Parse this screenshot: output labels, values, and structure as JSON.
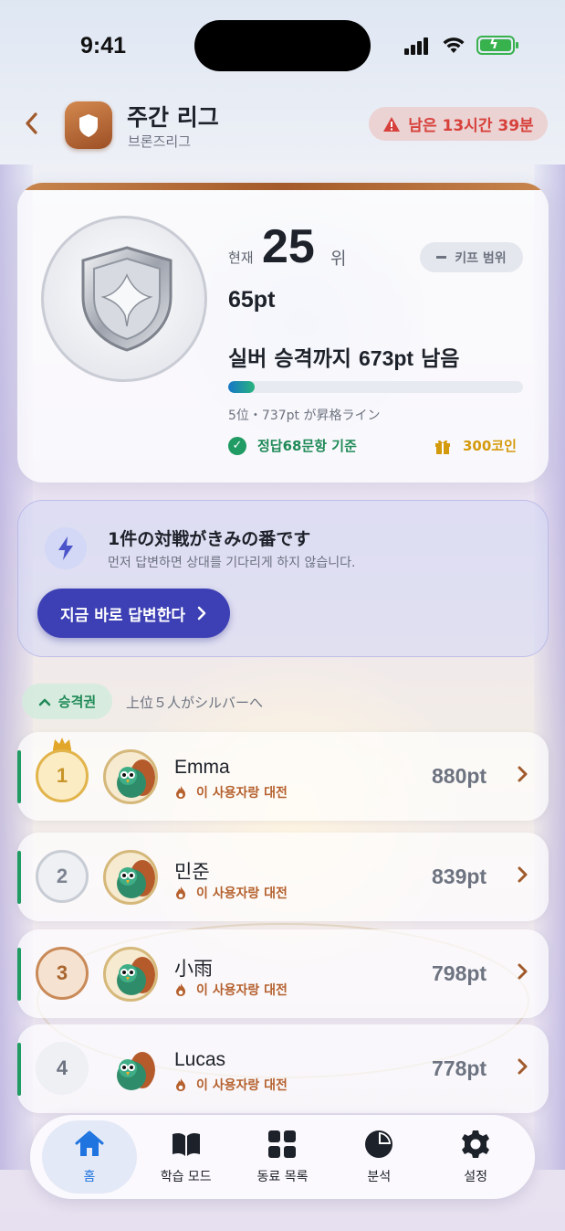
{
  "status_bar": {
    "time": "9:41"
  },
  "header": {
    "title": "주간 리그",
    "subtitle": "브론즈리그",
    "time_left_prefix": "남은 ",
    "time_left_value": "13시간 39분"
  },
  "rank_card": {
    "current_label": "현재",
    "rank": "25",
    "rank_unit": "위",
    "keep_label": "키프 범위",
    "points": "65pt",
    "promo_prefix": "실버 승격까지 ",
    "promo_value": "673pt",
    "promo_suffix": " 남음",
    "progress": 0.09,
    "line_info": "5位・737pt が昇格ライン",
    "criteria": "정답68문항 기준",
    "reward": "300코인"
  },
  "battle": {
    "title": "1件の対戦がきみの番です",
    "subtitle": "먼저 답변하면 상대를 기다리게 하지 않습니다.",
    "button": "지금 바로 답변한다"
  },
  "zone": {
    "label": "승격권",
    "description": "上位５人がシルバーへ"
  },
  "leaderboard": [
    {
      "rank": "1",
      "name": "Emma",
      "sub": "이 사용자랑 대전",
      "points": "880pt",
      "medal": "gold"
    },
    {
      "rank": "2",
      "name": "민준",
      "sub": "이 사용자랑 대전",
      "points": "839pt",
      "medal": "silver"
    },
    {
      "rank": "3",
      "name": "小雨",
      "sub": "이 사용자랑 대전",
      "points": "798pt",
      "medal": "bronze"
    },
    {
      "rank": "4",
      "name": "Lucas",
      "sub": "이 사용자랑 대전",
      "points": "778pt",
      "medal": "plain"
    }
  ],
  "tabs": [
    {
      "label": "홈",
      "icon": "home-icon",
      "active": true
    },
    {
      "label": "학습 모드",
      "icon": "book-icon",
      "active": false
    },
    {
      "label": "동료 목록",
      "icon": "grid-icon",
      "active": false
    },
    {
      "label": "분석",
      "icon": "pie-chart-icon",
      "active": false
    },
    {
      "label": "설정",
      "icon": "gear-icon",
      "active": false
    }
  ],
  "colors": {
    "accent": "#3d40b4",
    "promotion_green": "#1f9b63",
    "warning_red": "#d7413b",
    "bronze": "#a05a2c",
    "active_tab": "#1f74e0"
  }
}
